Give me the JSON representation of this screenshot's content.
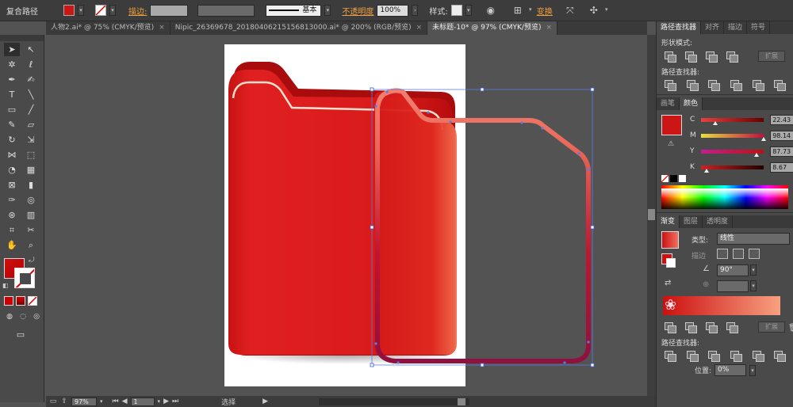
{
  "control_bar": {
    "object_type": "复合路径",
    "stroke_label": "描边:",
    "stroke_style": "基本",
    "opacity_label": "不透明度",
    "opacity_value": "100%",
    "style_label": "样式:",
    "transform_label": "变换"
  },
  "tabs": [
    {
      "label": "人物2.ai* @ 75% (CMYK/预览)",
      "active": false
    },
    {
      "label": "Nipic_26369678_20180406215156813000.ai* @ 200% (RGB/预览)",
      "active": false
    },
    {
      "label": "未标题-10* @ 97% (CMYK/预览)",
      "active": true
    }
  ],
  "tab_close": "×",
  "status_bar": {
    "zoom": "97%",
    "page": "1",
    "tool_name": "选择"
  },
  "pathfinder_panel": {
    "tabs": [
      "路径查找器",
      "对齐",
      "描边",
      "符号"
    ],
    "shape_modes_label": "形状模式:",
    "pathfinder_label": "路径查找器:",
    "expand_label": "扩展"
  },
  "color_panel": {
    "tabs": [
      "画笔",
      "颜色"
    ],
    "fill_color": "#cc1515",
    "channels": [
      {
        "name": "C",
        "value": "22.43",
        "percent": 22.43
      },
      {
        "name": "M",
        "value": "98.14",
        "percent": 98.14
      },
      {
        "name": "Y",
        "value": "87.73",
        "percent": 87.73
      },
      {
        "name": "K",
        "value": "8.67",
        "percent": 8.67
      }
    ]
  },
  "gradient_panel": {
    "tabs": [
      "渐变",
      "图层",
      "透明度"
    ],
    "type_label": "类型:",
    "type_value": "线性",
    "stroke_label": "描边",
    "angle_value": "90°",
    "gradient_start": "#cc1010",
    "gradient_end": "#f8a080"
  },
  "pathfinder_panel_2": {
    "pathfinder_label": "路径查找器:",
    "expand_label": "扩展",
    "position_label": "位置:",
    "position_value": "0%"
  },
  "colors": {
    "accent_orange": "#f0a040",
    "folder_red": "#d71a1a"
  }
}
